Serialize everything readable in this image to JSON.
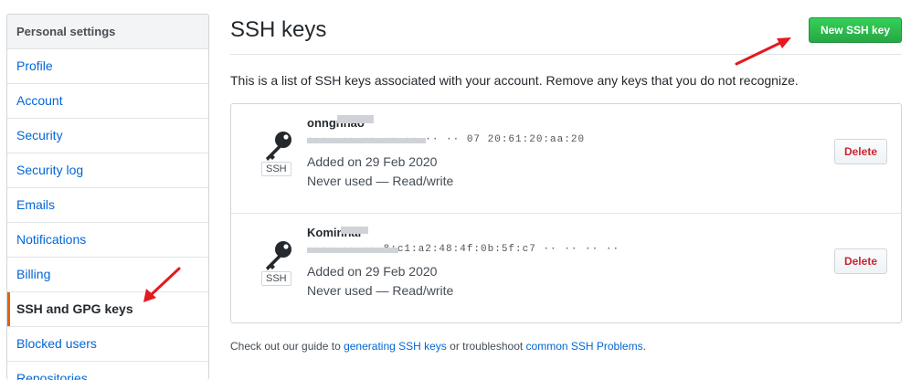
{
  "sidebar": {
    "header": "Personal settings",
    "items": [
      {
        "label": "Profile"
      },
      {
        "label": "Account"
      },
      {
        "label": "Security"
      },
      {
        "label": "Security log"
      },
      {
        "label": "Emails"
      },
      {
        "label": "Notifications"
      },
      {
        "label": "Billing"
      },
      {
        "label": "SSH and GPG keys",
        "selected": true
      },
      {
        "label": "Blocked users"
      },
      {
        "label": "Repositories"
      }
    ]
  },
  "main": {
    "title": "SSH keys",
    "new_key_button": "New SSH key",
    "description": "This is a list of SSH keys associated with your account. Remove any keys that you do not recognize.",
    "keys": [
      {
        "title": "onngnhao",
        "fingerprint": "···· ·· ·· ·· ·· ·· ·· 07 20:61:20:aa:20",
        "badge": "SSH",
        "added": "Added on 29 Feb 2020",
        "usage": "Never used — Read/write",
        "delete_label": "Delete"
      },
      {
        "title": "Kominnar",
        "fingerprint": "···· ·· ·· 8:c1:a2:48:4f:0b:5f:c7 ·· ·· ·· ··",
        "badge": "SSH",
        "added": "Added on 29 Feb 2020",
        "usage": "Never used — Read/write",
        "delete_label": "Delete"
      }
    ],
    "footer": {
      "prefix": "Check out our guide to ",
      "link1": "generating SSH keys",
      "middle": " or troubleshoot ",
      "link2": "common SSH Problems",
      "suffix": "."
    }
  },
  "colors": {
    "link": "#0366d6",
    "primary_button": "#28a745",
    "danger_text": "#cb2431",
    "selected_indicator": "#e36209",
    "annotation_arrow": "#e5191f"
  },
  "icons": {
    "key": "key-icon",
    "arrow": "annotation-arrow-icon"
  }
}
